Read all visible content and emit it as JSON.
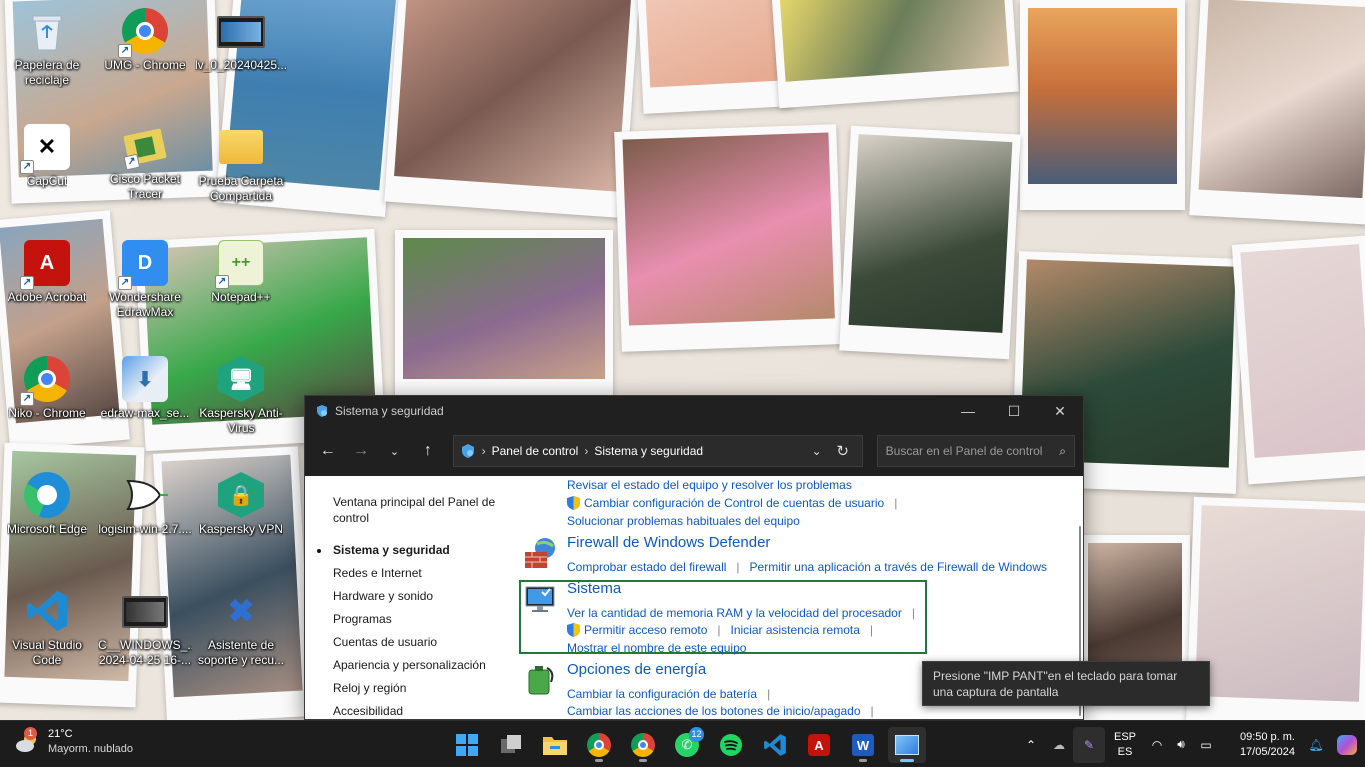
{
  "desktop": {
    "icons": [
      {
        "label": "Papelera de reciclaje",
        "icon": "recycle-bin-icon"
      },
      {
        "label": "UMG - Chrome",
        "icon": "chrome-icon"
      },
      {
        "label": "lv_0_20240425...",
        "icon": "video-file-icon"
      },
      {
        "label": "CapCut",
        "icon": "capcut-icon"
      },
      {
        "label": "Cisco Packet Tracer",
        "icon": "packet-tracer-icon"
      },
      {
        "label": "Prueba Carpeta Compartida",
        "icon": "folder-icon"
      },
      {
        "label": "Adobe Acrobat",
        "icon": "acrobat-icon"
      },
      {
        "label": "Wondershare EdrawMax",
        "icon": "edrawmax-icon"
      },
      {
        "label": "Notepad++",
        "icon": "notepad-plus-plus-icon"
      },
      {
        "label": "Niko - Chrome",
        "icon": "chrome-icon"
      },
      {
        "label": "edraw-max_se...",
        "icon": "installer-icon"
      },
      {
        "label": "Kaspersky Anti-Virus",
        "icon": "kaspersky-antivirus-icon"
      },
      {
        "label": "Microsoft Edge",
        "icon": "edge-icon"
      },
      {
        "label": "logisim-win-2.7....",
        "icon": "logisim-icon"
      },
      {
        "label": "Kaspersky VPN",
        "icon": "kaspersky-vpn-icon"
      },
      {
        "label": "Visual Studio Code",
        "icon": "vscode-icon"
      },
      {
        "label": "C__WINDOWS_... 2024-04-25 16-...",
        "icon": "video-file-icon"
      },
      {
        "label": "Asistente de soporte y recu...",
        "icon": "support-assistant-icon"
      }
    ]
  },
  "window": {
    "title": "Sistema y seguridad",
    "address": {
      "root": "Panel de control",
      "current": "Sistema y seguridad"
    },
    "search_placeholder": "Buscar en el Panel de control",
    "leftnav": {
      "home": "Ventana principal del Panel de control",
      "items": [
        "Sistema y seguridad",
        "Redes e Internet",
        "Hardware y sonido",
        "Programas",
        "Cuentas de usuario",
        "Apariencia y personalización",
        "Reloj y región",
        "Accesibilidad"
      ]
    },
    "sections": {
      "security": {
        "link1": "Revisar el estado del equipo y resolver los problemas",
        "link2": "Cambiar configuración de Control de cuentas de usuario",
        "link3": "Solucionar problemas habituales del equipo"
      },
      "firewall": {
        "title": "Firewall de Windows Defender",
        "link1": "Comprobar estado del firewall",
        "link2": "Permitir una aplicación a través de Firewall de Windows"
      },
      "system": {
        "title": "Sistema",
        "link1": "Ver la cantidad de memoria RAM y la velocidad del procesador",
        "link2": "Permitir acceso remoto",
        "link3": "Iniciar asistencia remota",
        "link4": "Mostrar el nombre de este equipo"
      },
      "power": {
        "title": "Opciones de energía",
        "link1": "Cambiar la configuración de batería",
        "link2": "Cambiar las acciones de los botones de inicio/apagado"
      }
    }
  },
  "tooltip": {
    "text": "Presione \"IMP PANT\"en el teclado para tomar una captura de pantalla"
  },
  "taskbar": {
    "weather": {
      "temp": "21°C",
      "desc": "Mayorm. nublado",
      "alert_count": "1"
    },
    "apps": [
      {
        "name": "start",
        "icon": "windows-start-icon"
      },
      {
        "name": "task-view",
        "icon": "task-view-icon"
      },
      {
        "name": "file-explorer",
        "icon": "file-explorer-icon"
      },
      {
        "name": "chrome-profile",
        "icon": "chrome-icon"
      },
      {
        "name": "chrome",
        "icon": "chrome-icon"
      },
      {
        "name": "whatsapp",
        "icon": "whatsapp-icon",
        "badge": "12"
      },
      {
        "name": "spotify",
        "icon": "spotify-icon"
      },
      {
        "name": "vscode",
        "icon": "vscode-icon"
      },
      {
        "name": "acrobat",
        "icon": "acrobat-icon"
      },
      {
        "name": "word",
        "icon": "word-icon"
      },
      {
        "name": "control-panel",
        "icon": "control-panel-icon"
      }
    ],
    "lang_top": "ESP",
    "lang_bottom": "ES",
    "time": "09:50 p. m.",
    "date": "17/05/2024"
  },
  "colors": {
    "link": "#0b5bc3",
    "highlight": "#1f7a3a",
    "taskbar": "#1c1c1c",
    "titlebar": "#202020"
  }
}
